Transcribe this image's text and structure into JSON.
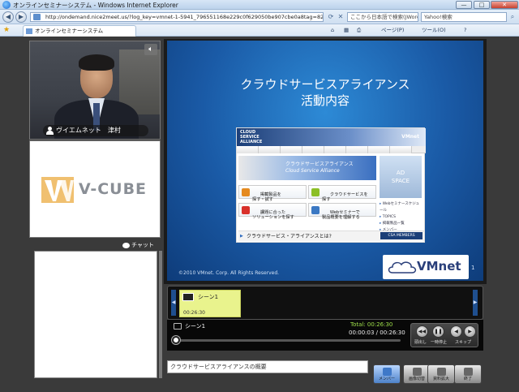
{
  "browser": {
    "window_title": "オンラインセミナーシステム - Windows Internet Explorer",
    "url": "http://ondemand.nice2meet.us/?log_key=vmnet-1-5941_796551168e229c0f629050be907cbe0a8tag=8251a48",
    "search_hint": "ここから日本語で検索(JWord)",
    "yahoo_placeholder": "Yahoo!検索",
    "tab_title": "オンラインセミナーシステム",
    "page_menu": "ページ(P)",
    "tools_menu": "ツール(O)",
    "window_buttons": {
      "minimize": "—",
      "maximize": "□",
      "close": "✕"
    }
  },
  "video": {
    "speaker_name": "ヴイエムネット　津村"
  },
  "branding": {
    "logo_text": "V-CUBE"
  },
  "chat": {
    "label": "チャット"
  },
  "slide": {
    "title": "クラウドサービスアライアンス\n活動内容",
    "site": {
      "header_logo": "CLOUD\nSERVICE\nALLIANCE",
      "header_brand": "VMnet",
      "banner_jp": "クラウドサービスアライアンス",
      "banner_en": "Cloud Service Alliance",
      "ad_text": "AD\nSPACE",
      "cards": [
        {
          "text": "掲載製品を\n探す・試す",
          "color": "#e58a1f"
        },
        {
          "text": "クラウドサービスを\n探す",
          "color": "#8cbf26"
        },
        {
          "text": "課題に合った\nソリューションを探す",
          "color": "#d9312b"
        },
        {
          "text": "Webセミナーで\n製品概要を理解する",
          "color": "#3b78c3"
        }
      ],
      "side_links": [
        "Webセミナースケジュール",
        "TOPICS",
        "掲載製品一覧",
        "メンバー"
      ],
      "footer": "クラウドサービス・アライアンスとは?",
      "members": "CSA MEMBERS"
    },
    "copyright": "©2010  VMnet. Corp.  All Rights Reserved.",
    "brand": "VMnet",
    "page_number": "1"
  },
  "timeline": {
    "scene_title": "シーン1",
    "scene_time": "00:26:30"
  },
  "controls": {
    "scene_name": "シーン1",
    "total": "Total: 00:26:30",
    "current": "00:00:03 / 00:26:30",
    "progress": 0.002,
    "play_labels": [
      "頭出し",
      "一時停止",
      "スキップ"
    ]
  },
  "bottom": {
    "caption": "クラウドサービスアライアンスの概要",
    "tools": [
      {
        "label": "メンバー",
        "color": "#3e78c8",
        "active": true
      },
      {
        "label": "画像切替",
        "color": "#666"
      },
      {
        "label": "資料拡大",
        "color": "#666"
      },
      {
        "label": "終了",
        "color": "#666"
      }
    ]
  },
  "colors": {
    "slide_bg": "#1a5aa6",
    "scene_card": "#e9f38d",
    "total_text": "#9fe04a"
  }
}
